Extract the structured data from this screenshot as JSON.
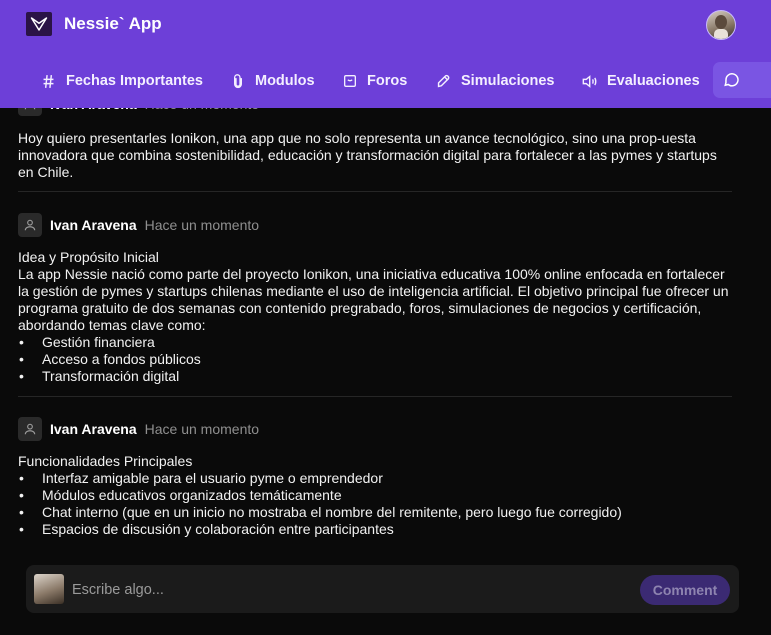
{
  "app": {
    "title": "Nessie` App"
  },
  "nav": {
    "items": [
      {
        "label": "Fechas Importantes",
        "icon": "hash-icon"
      },
      {
        "label": "Modulos",
        "icon": "paperclip-icon"
      },
      {
        "label": "Foros",
        "icon": "message-square-icon"
      },
      {
        "label": "Simulaciones",
        "icon": "rocket-icon"
      },
      {
        "label": "Evaluaciones",
        "icon": "speaker-icon"
      }
    ],
    "active_icon": "chat-icon"
  },
  "posts": [
    {
      "author": "Ivan Aravena",
      "time": "Hace un momento",
      "paragraphs": [
        "Hoy quiero presentarles Ionikon, una app que no solo representa un avance tecnológico, sino una prop-uesta innovadora que combina sostenibilidad, educación y transformación digital para fortalecer a las pymes y startups en Chile."
      ]
    },
    {
      "author": "Ivan Aravena",
      "time": "Hace un momento",
      "paragraphs": [
        "Idea y Propósito Inicial",
        "La app Nessie nació como parte del proyecto Ionikon, una iniciativa educativa 100% online enfocada en fortalecer la gestión de pymes y startups chilenas mediante el uso de inteligencia artificial. El objetivo principal fue ofrecer un programa gratuito de dos semanas con contenido pregrabado, foros, simulaciones de negocios y certificación, abordando temas clave como:"
      ],
      "bullets": [
        "Gestión financiera",
        "Acceso a fondos públicos",
        "Transformación digital"
      ]
    },
    {
      "author": "Ivan Aravena",
      "time": "Hace un momento",
      "paragraphs": [
        "Funcionalidades Principales"
      ],
      "bullets": [
        "Interfaz amigable para el usuario pyme o emprendedor",
        "Módulos educativos organizados temáticamente",
        "Chat interno (que en un inicio no mostraba el nombre del remitente, pero luego fue corregido)",
        "Espacios de discusión y colaboración entre participantes"
      ]
    }
  ],
  "comment": {
    "placeholder": "Escribe algo...",
    "button_label": "Comment"
  },
  "colors": {
    "header": "#6d3fd8",
    "background": "#0a0a0a",
    "comment_button": "#3b2a73"
  }
}
